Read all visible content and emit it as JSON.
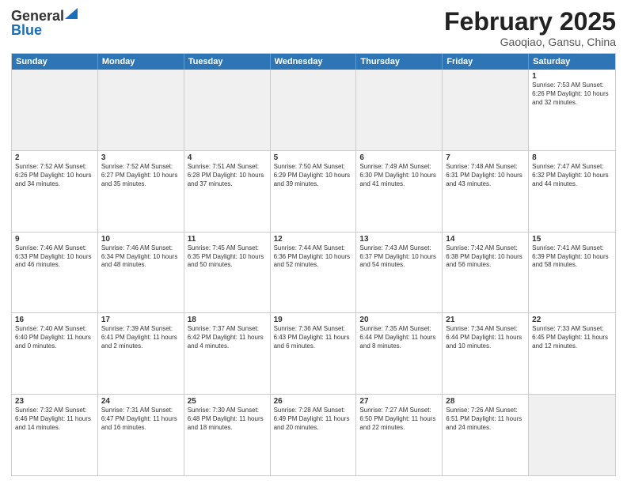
{
  "header": {
    "logo_general": "General",
    "logo_blue": "Blue",
    "month_title": "February 2025",
    "location": "Gaoqiao, Gansu, China"
  },
  "day_headers": [
    "Sunday",
    "Monday",
    "Tuesday",
    "Wednesday",
    "Thursday",
    "Friday",
    "Saturday"
  ],
  "weeks": [
    [
      {
        "day": "",
        "text": "",
        "shaded": true
      },
      {
        "day": "",
        "text": "",
        "shaded": true
      },
      {
        "day": "",
        "text": "",
        "shaded": true
      },
      {
        "day": "",
        "text": "",
        "shaded": true
      },
      {
        "day": "",
        "text": "",
        "shaded": true
      },
      {
        "day": "",
        "text": "",
        "shaded": true
      },
      {
        "day": "1",
        "text": "Sunrise: 7:53 AM\nSunset: 6:26 PM\nDaylight: 10 hours and 32 minutes.",
        "shaded": false
      }
    ],
    [
      {
        "day": "2",
        "text": "Sunrise: 7:52 AM\nSunset: 6:26 PM\nDaylight: 10 hours and 34 minutes.",
        "shaded": false
      },
      {
        "day": "3",
        "text": "Sunrise: 7:52 AM\nSunset: 6:27 PM\nDaylight: 10 hours and 35 minutes.",
        "shaded": false
      },
      {
        "day": "4",
        "text": "Sunrise: 7:51 AM\nSunset: 6:28 PM\nDaylight: 10 hours and 37 minutes.",
        "shaded": false
      },
      {
        "day": "5",
        "text": "Sunrise: 7:50 AM\nSunset: 6:29 PM\nDaylight: 10 hours and 39 minutes.",
        "shaded": false
      },
      {
        "day": "6",
        "text": "Sunrise: 7:49 AM\nSunset: 6:30 PM\nDaylight: 10 hours and 41 minutes.",
        "shaded": false
      },
      {
        "day": "7",
        "text": "Sunrise: 7:48 AM\nSunset: 6:31 PM\nDaylight: 10 hours and 43 minutes.",
        "shaded": false
      },
      {
        "day": "8",
        "text": "Sunrise: 7:47 AM\nSunset: 6:32 PM\nDaylight: 10 hours and 44 minutes.",
        "shaded": false
      }
    ],
    [
      {
        "day": "9",
        "text": "Sunrise: 7:46 AM\nSunset: 6:33 PM\nDaylight: 10 hours and 46 minutes.",
        "shaded": false
      },
      {
        "day": "10",
        "text": "Sunrise: 7:46 AM\nSunset: 6:34 PM\nDaylight: 10 hours and 48 minutes.",
        "shaded": false
      },
      {
        "day": "11",
        "text": "Sunrise: 7:45 AM\nSunset: 6:35 PM\nDaylight: 10 hours and 50 minutes.",
        "shaded": false
      },
      {
        "day": "12",
        "text": "Sunrise: 7:44 AM\nSunset: 6:36 PM\nDaylight: 10 hours and 52 minutes.",
        "shaded": false
      },
      {
        "day": "13",
        "text": "Sunrise: 7:43 AM\nSunset: 6:37 PM\nDaylight: 10 hours and 54 minutes.",
        "shaded": false
      },
      {
        "day": "14",
        "text": "Sunrise: 7:42 AM\nSunset: 6:38 PM\nDaylight: 10 hours and 56 minutes.",
        "shaded": false
      },
      {
        "day": "15",
        "text": "Sunrise: 7:41 AM\nSunset: 6:39 PM\nDaylight: 10 hours and 58 minutes.",
        "shaded": false
      }
    ],
    [
      {
        "day": "16",
        "text": "Sunrise: 7:40 AM\nSunset: 6:40 PM\nDaylight: 11 hours and 0 minutes.",
        "shaded": false
      },
      {
        "day": "17",
        "text": "Sunrise: 7:39 AM\nSunset: 6:41 PM\nDaylight: 11 hours and 2 minutes.",
        "shaded": false
      },
      {
        "day": "18",
        "text": "Sunrise: 7:37 AM\nSunset: 6:42 PM\nDaylight: 11 hours and 4 minutes.",
        "shaded": false
      },
      {
        "day": "19",
        "text": "Sunrise: 7:36 AM\nSunset: 6:43 PM\nDaylight: 11 hours and 6 minutes.",
        "shaded": false
      },
      {
        "day": "20",
        "text": "Sunrise: 7:35 AM\nSunset: 6:44 PM\nDaylight: 11 hours and 8 minutes.",
        "shaded": false
      },
      {
        "day": "21",
        "text": "Sunrise: 7:34 AM\nSunset: 6:44 PM\nDaylight: 11 hours and 10 minutes.",
        "shaded": false
      },
      {
        "day": "22",
        "text": "Sunrise: 7:33 AM\nSunset: 6:45 PM\nDaylight: 11 hours and 12 minutes.",
        "shaded": false
      }
    ],
    [
      {
        "day": "23",
        "text": "Sunrise: 7:32 AM\nSunset: 6:46 PM\nDaylight: 11 hours and 14 minutes.",
        "shaded": false
      },
      {
        "day": "24",
        "text": "Sunrise: 7:31 AM\nSunset: 6:47 PM\nDaylight: 11 hours and 16 minutes.",
        "shaded": false
      },
      {
        "day": "25",
        "text": "Sunrise: 7:30 AM\nSunset: 6:48 PM\nDaylight: 11 hours and 18 minutes.",
        "shaded": false
      },
      {
        "day": "26",
        "text": "Sunrise: 7:28 AM\nSunset: 6:49 PM\nDaylight: 11 hours and 20 minutes.",
        "shaded": false
      },
      {
        "day": "27",
        "text": "Sunrise: 7:27 AM\nSunset: 6:50 PM\nDaylight: 11 hours and 22 minutes.",
        "shaded": false
      },
      {
        "day": "28",
        "text": "Sunrise: 7:26 AM\nSunset: 6:51 PM\nDaylight: 11 hours and 24 minutes.",
        "shaded": false
      },
      {
        "day": "",
        "text": "",
        "shaded": true
      }
    ]
  ]
}
